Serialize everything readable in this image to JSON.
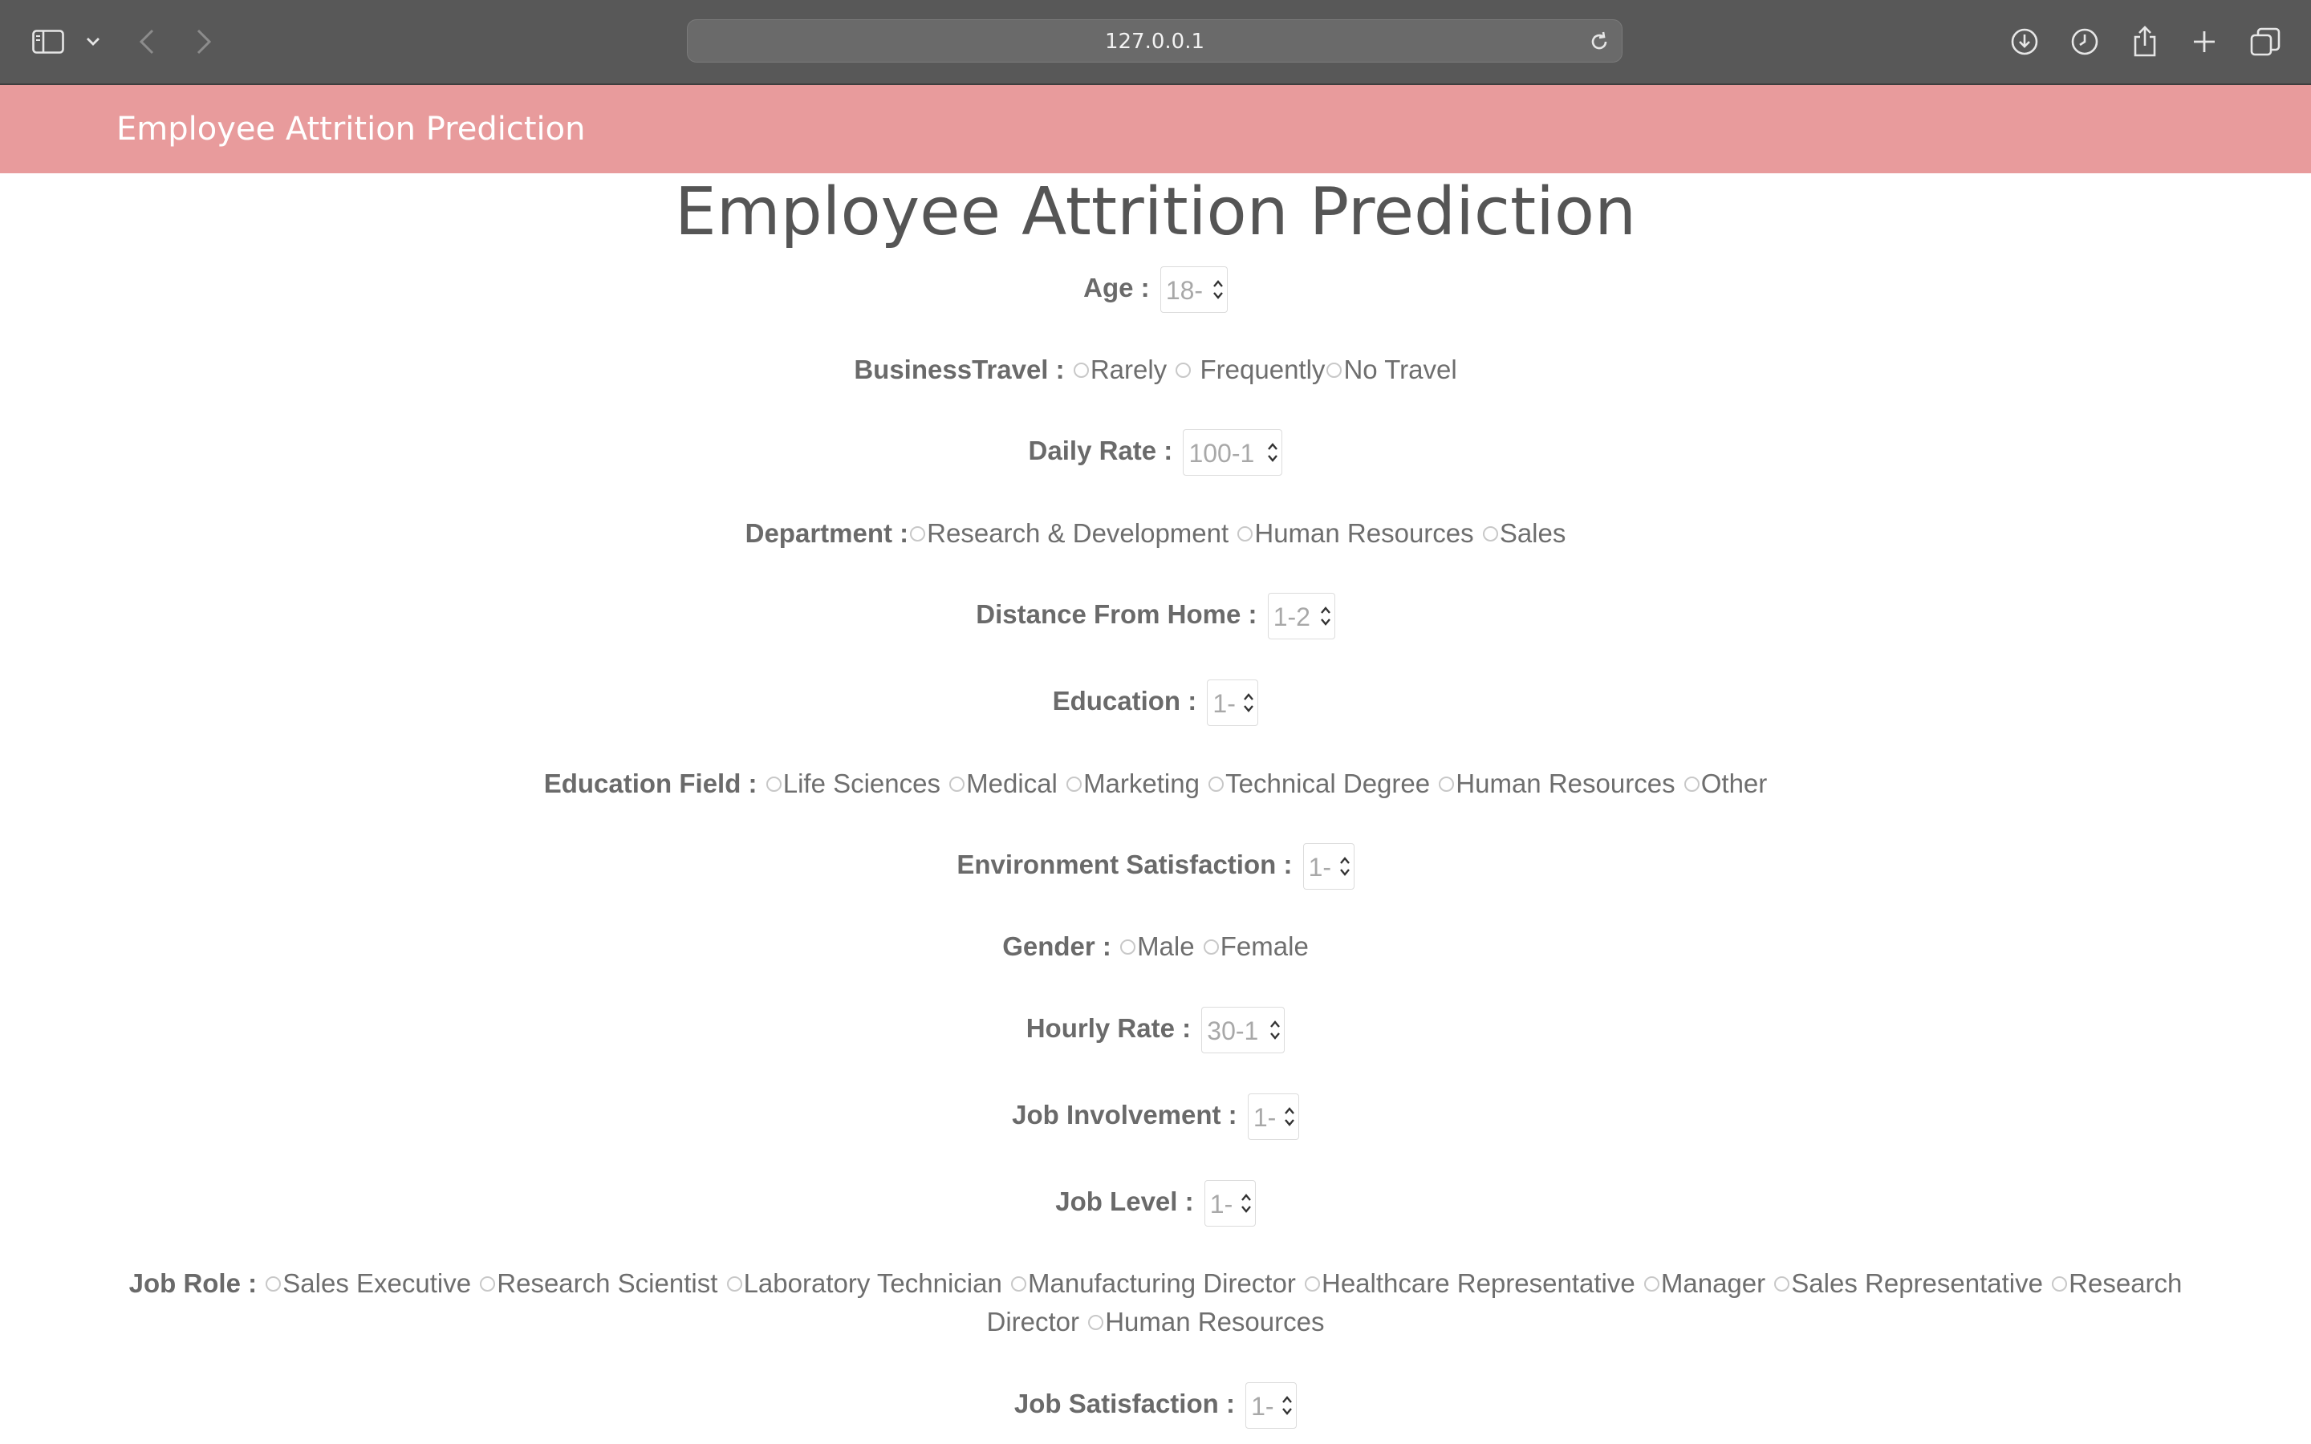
{
  "browser": {
    "url": "127.0.0.1"
  },
  "app": {
    "brand": "Employee Attrition Prediction",
    "title": "Employee Attrition Prediction"
  },
  "form": {
    "age": {
      "label": "Age :",
      "placeholder": "18-"
    },
    "business_travel": {
      "label": "BusinessTravel :",
      "options": [
        "Rarely",
        "Frequently",
        "No Travel"
      ]
    },
    "daily_rate": {
      "label": "Daily Rate :",
      "placeholder": "100-1"
    },
    "department": {
      "label": "Department :",
      "options": [
        "Research & Development",
        "Human Resources",
        "Sales"
      ]
    },
    "distance_from_home": {
      "label": "Distance From Home :",
      "placeholder": "1-2"
    },
    "education": {
      "label": "Education :",
      "placeholder": "1-"
    },
    "education_field": {
      "label": "Education Field :",
      "options": [
        "Life Sciences",
        "Medical",
        "Marketing",
        "Technical Degree",
        "Human Resources",
        "Other"
      ]
    },
    "environment_satisfaction": {
      "label": "Environment Satisfaction :",
      "placeholder": "1-"
    },
    "gender": {
      "label": "Gender :",
      "options": [
        "Male",
        "Female"
      ]
    },
    "hourly_rate": {
      "label": "Hourly Rate :",
      "placeholder": "30-1"
    },
    "job_involvement": {
      "label": "Job Involvement :",
      "placeholder": "1-"
    },
    "job_level": {
      "label": "Job Level :",
      "placeholder": "1-"
    },
    "job_role": {
      "label": "Job Role :",
      "options": [
        "Sales Executive",
        "Research Scientist",
        "Laboratory Technician",
        "Manufacturing Director",
        "Healthcare Representative",
        "Manager",
        "Sales Representative",
        "Research Director",
        "Human Resources"
      ]
    },
    "job_satisfaction": {
      "label": "Job Satisfaction :",
      "placeholder": "1-"
    }
  }
}
